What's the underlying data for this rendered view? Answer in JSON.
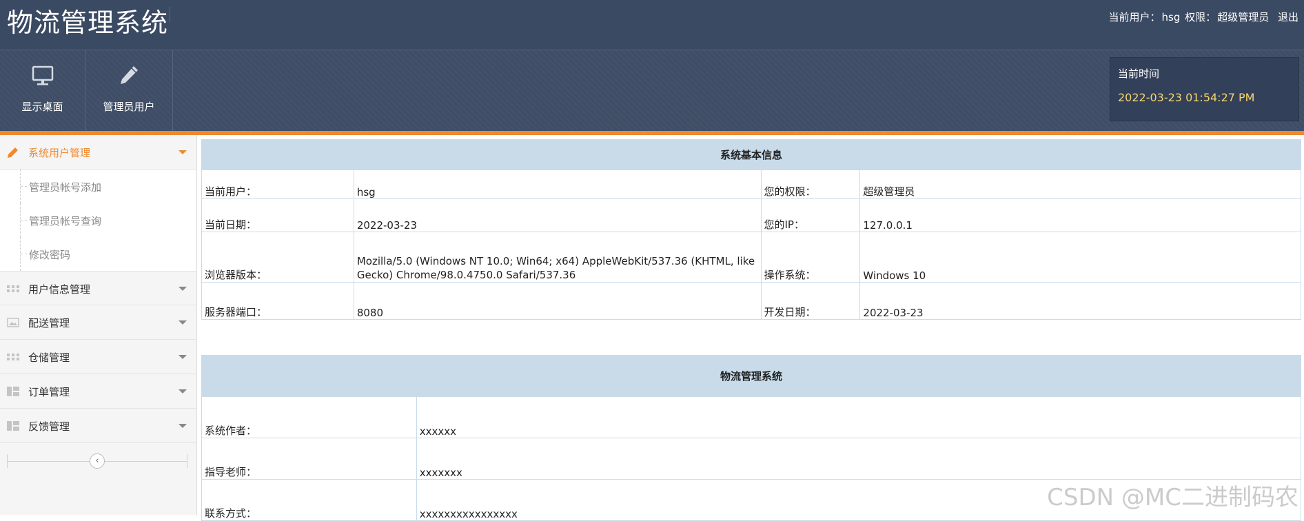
{
  "header": {
    "app_title": "物流管理系统",
    "current_user_label": "当前用户：",
    "current_user": "hsg",
    "role_label": "权限：",
    "role": "超级管理员",
    "logout": "退出"
  },
  "toolbar": {
    "buttons": [
      {
        "label": "显示桌面",
        "icon": "monitor-icon"
      },
      {
        "label": "管理员用户",
        "icon": "pencil-icon"
      }
    ],
    "clock_label": "当前时间",
    "clock_value": "2022-03-23 01:54:27 PM"
  },
  "sidebar": {
    "groups": [
      {
        "label": "系统用户管理",
        "icon": "pencil-icon",
        "active": true
      },
      {
        "label": "用户信息管理",
        "icon": "grid-icon"
      },
      {
        "label": "配送管理",
        "icon": "image-icon"
      },
      {
        "label": "仓储管理",
        "icon": "grid-icon"
      },
      {
        "label": "订单管理",
        "icon": "layout-icon"
      },
      {
        "label": "反馈管理",
        "icon": "layout-icon"
      }
    ],
    "submenu": [
      "管理员帐号添加",
      "管理员帐号查询",
      "修改密码"
    ],
    "collapse_glyph": "‹"
  },
  "basic_info": {
    "caption": "系统基本信息",
    "rows": [
      {
        "l1": "当前用户：",
        "v1": "hsg",
        "l2": "您的权限：",
        "v2": "超级管理员"
      },
      {
        "l1": "当前日期：",
        "v1": "2022-03-23",
        "l2": "您的IP：",
        "v2": "127.0.0.1"
      },
      {
        "l1": "浏览器版本：",
        "v1": "Mozilla/5.0 (Windows NT 10.0; Win64; x64) AppleWebKit/537.36 (KHTML, like Gecko) Chrome/98.0.4750.0 Safari/537.36",
        "l2": "操作系统：",
        "v2": "Windows 10"
      },
      {
        "l1": "服务器端口：",
        "v1": "8080",
        "l2": "开发日期：",
        "v2": "2022-03-23"
      }
    ]
  },
  "system_info": {
    "caption": "物流管理系统",
    "rows": [
      {
        "label": "系统作者：",
        "value": "xxxxxx"
      },
      {
        "label": "指导老师：",
        "value": "xxxxxxx"
      },
      {
        "label": "联系方式：",
        "value": "xxxxxxxxxxxxxxxx"
      }
    ]
  },
  "watermark": "CSDN @MC二进制码农",
  "colors": {
    "header_bg": "#3b4a63",
    "accent_orange": "#f0892e",
    "table_header": "#c9dbe9",
    "clock_text": "#f5d76e"
  }
}
